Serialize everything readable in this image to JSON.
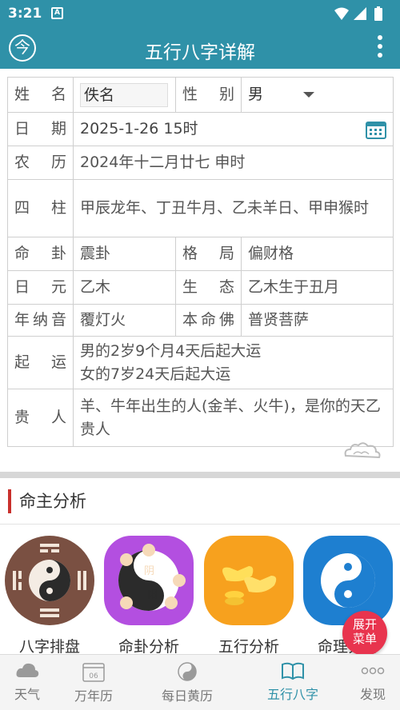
{
  "status": {
    "time": "3:21",
    "notif_icon": "A"
  },
  "appbar": {
    "title": "五行八字详解"
  },
  "info": {
    "name_label": "姓 名",
    "name_value": "佚名",
    "gender_label": "性 别",
    "gender_value": "男",
    "date_label": "日 期",
    "date_value": "2025-1-26 15时",
    "lunar_label": "农 历",
    "lunar_value": "2024年十二月廿七 申时",
    "pillars_label": "四 柱",
    "pillars_value": "甲辰龙年、丁丑牛月、乙未羊日、甲申猴时",
    "gua_label": "命 卦",
    "gua_value": "震卦",
    "geju_label": "格 局",
    "geju_value": "偏财格",
    "riyuan_label": "日 元",
    "riyuan_value": "乙木",
    "shengtai_label": "生 态",
    "shengtai_value": "乙木生于丑月",
    "nayin_label": "年纳音",
    "nayin_value": "覆灯火",
    "buddha_label": "本命佛",
    "buddha_value": "普贤菩萨",
    "qiyun_label": "起 运",
    "qiyun_male": "男的2岁9个月4天后起大运",
    "qiyun_female": "女的7岁24天后起大运",
    "guiren_label": "贵 人",
    "guiren_value": "羊、牛年出生的人(金羊、火牛)，是你的天乙贵人"
  },
  "section": {
    "title": "命主分析"
  },
  "tools": [
    {
      "label": "八字排盘"
    },
    {
      "label": "命卦分析"
    },
    {
      "label": "五行分析"
    },
    {
      "label": "命理分析"
    }
  ],
  "fab": {
    "line1": "展开",
    "line2": "菜单"
  },
  "nav": {
    "weather": "天气",
    "calendar": "万年历",
    "calendar_day": "06",
    "almanac": "每日黄历",
    "bazi": "五行八字",
    "discover": "发现"
  },
  "colors": {
    "primary": "#2f91a8",
    "accent": "#e8344e",
    "section_bar": "#c9302c"
  }
}
